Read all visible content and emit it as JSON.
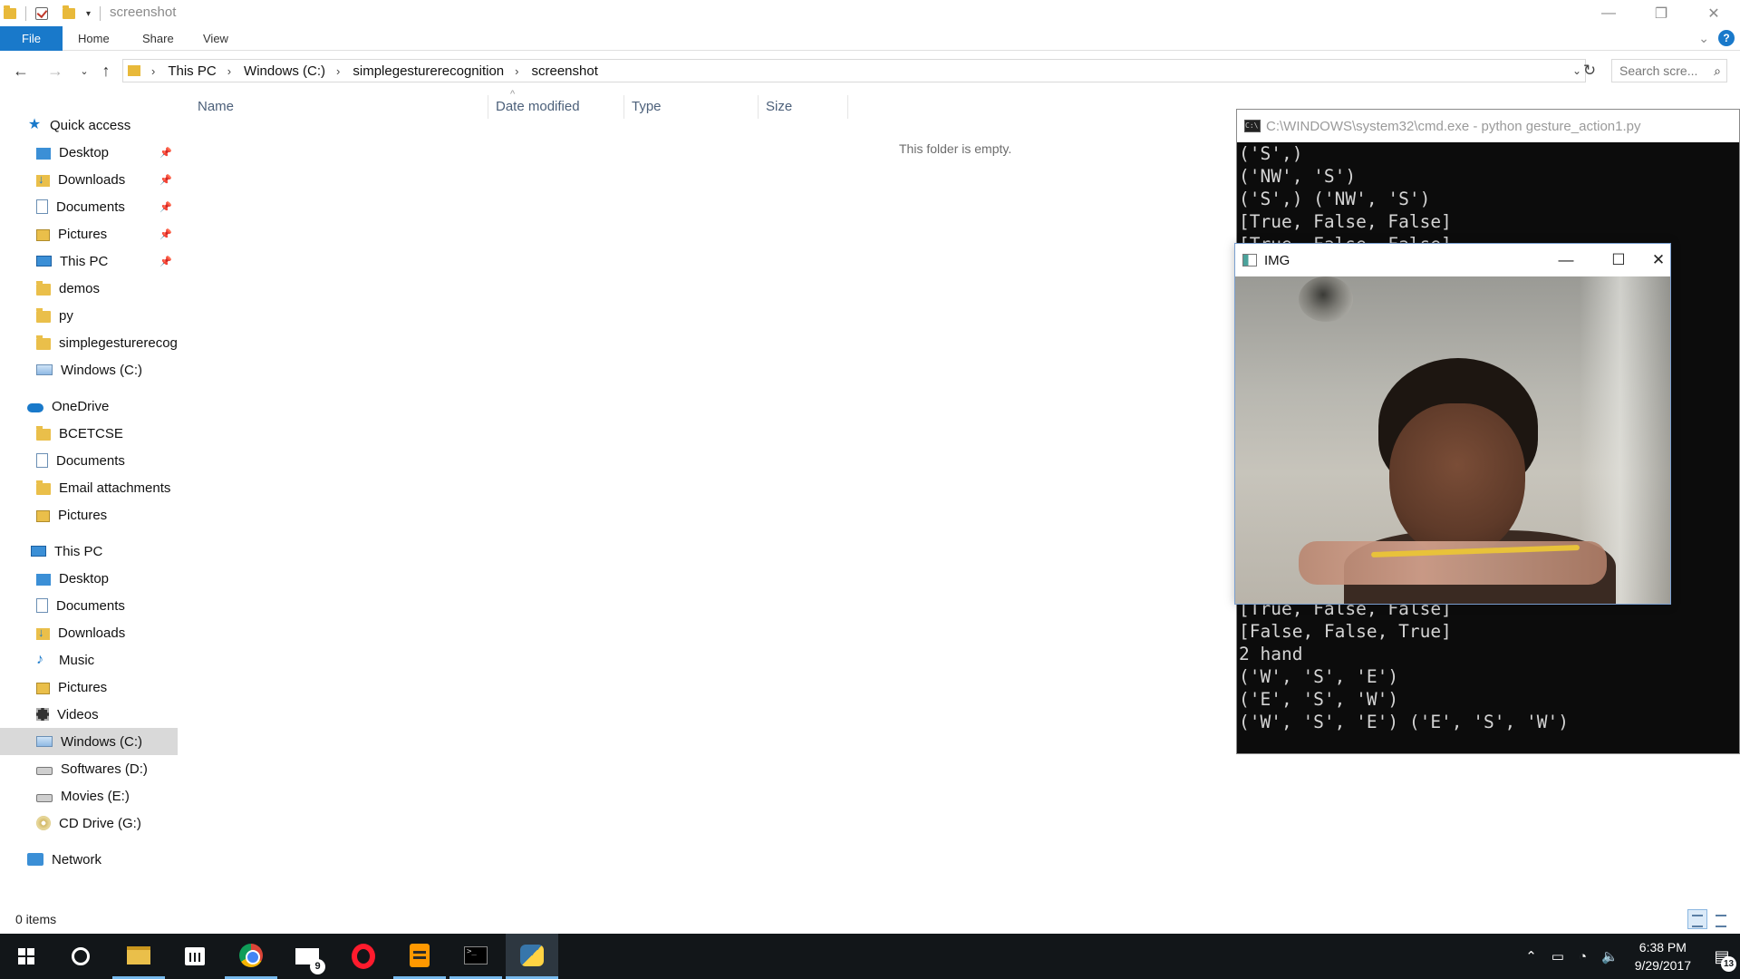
{
  "explorer": {
    "window_title": "screenshot",
    "ribbon_tabs": [
      "File",
      "Home",
      "Share",
      "View"
    ],
    "breadcrumb": [
      "This PC",
      "Windows (C:)",
      "simplegesturerecognition",
      "screenshot"
    ],
    "search_placeholder": "Search scre...",
    "columns": [
      "Name",
      "Date modified",
      "Type",
      "Size"
    ],
    "empty_message": "This folder is empty.",
    "status": "0 items",
    "nav": {
      "quick_access": "Quick access",
      "quick_items": [
        "Desktop",
        "Downloads",
        "Documents",
        "Pictures",
        "This PC",
        "demos",
        "py",
        "simplegesturerecog",
        "Windows (C:)"
      ],
      "onedrive": "OneDrive",
      "onedrive_items": [
        "BCETCSE",
        "Documents",
        "Email attachments",
        "Pictures"
      ],
      "this_pc": "This PC",
      "pc_items": [
        "Desktop",
        "Documents",
        "Downloads",
        "Music",
        "Pictures",
        "Videos",
        "Windows (C:)",
        "Softwares (D:)",
        "Movies (E:)",
        "CD Drive (G:)"
      ],
      "network": "Network"
    }
  },
  "cmd": {
    "title": "C:\\WINDOWS\\system32\\cmd.exe - python  gesture_action1.py",
    "lines_top": [
      "('S',)",
      "('NW', 'S')",
      "('S',) ('NW', 'S')",
      "[True, False, False]",
      "[True, False, False]"
    ],
    "lines_bottom": [
      "[True, False, False]",
      "[False, False, True]",
      "2 hand",
      "('W', 'S', 'E')",
      "('E', 'S', 'W')",
      "('W', 'S', 'E') ('E', 'S', 'W')"
    ]
  },
  "img_window": {
    "title": "IMG"
  },
  "taskbar": {
    "mail_badge": "9",
    "time": "6:38 PM",
    "date": "9/29/2017",
    "notification_count": "13"
  }
}
